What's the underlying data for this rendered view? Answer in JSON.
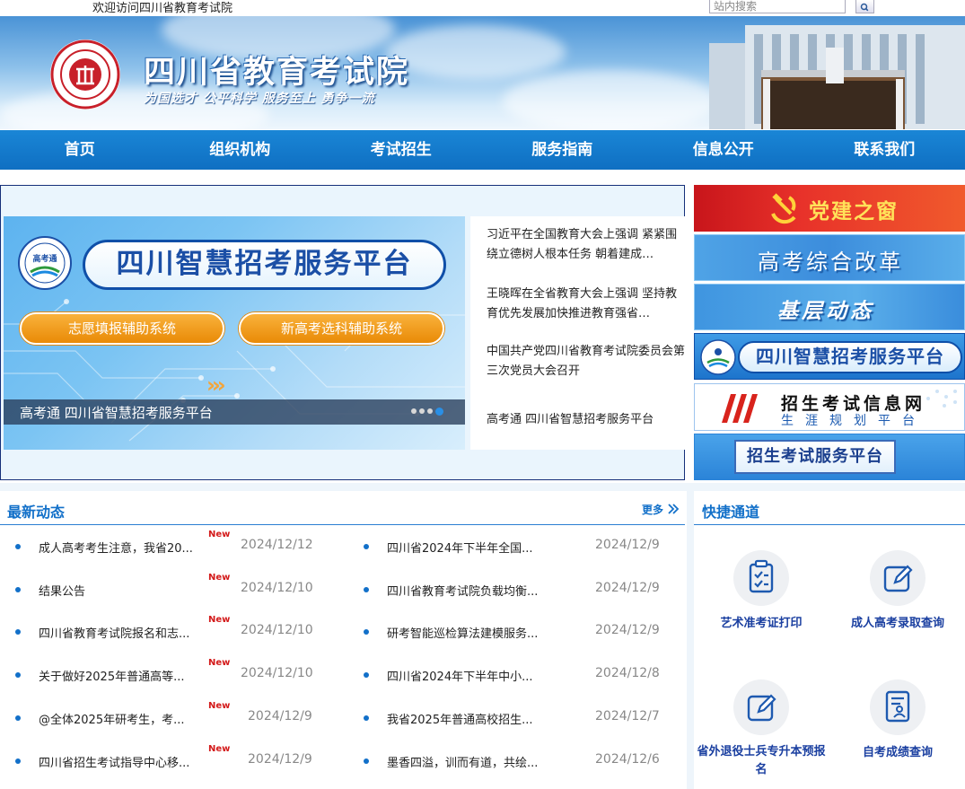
{
  "topbar": {
    "welcome": "欢迎访问四川省教育考试院",
    "search_placeholder": "站内搜索"
  },
  "header": {
    "title": "四川省教育考试院",
    "slogan": "为国选才  公平科学  服务至上  勇争一流"
  },
  "nav": {
    "items": [
      "首页",
      "组织机构",
      "考试招生",
      "服务指南",
      "信息公开",
      "联系我们"
    ]
  },
  "slider": {
    "title": "四川智慧招考服务平台",
    "button_1": "志愿填报辅助系统",
    "button_2": "新高考选科辅助系统",
    "caption": "高考通 四川省智慧招考服务平台",
    "logo_text": "高考通",
    "total_slides": 4,
    "active_slide": 4
  },
  "headlines": [
    "习近平在全国教育大会上强调 紧紧围绕立德树人根本任务 朝着建成…",
    "王晓晖在全省教育大会上强调 坚持教育优先发展加快推进教育强省…",
    "中国共产党四川省教育考试院委员会第三次党员大会召开",
    "高考通 四川省智慧招考服务平台"
  ],
  "side_banners": {
    "party": "党建之窗",
    "reform": "高考综合改革",
    "grassroots": "基层动态",
    "smart": "四川智慧招考服务平台",
    "info_line1": "招生考试信息网",
    "info_line2": "生涯规划平台",
    "service": "招生考试服务平台"
  },
  "news": {
    "title": "最新动态",
    "more": "更多",
    "new_badge": "New",
    "left": [
      {
        "text": "成人高考考生注意，我省20...",
        "date": "2024/12/12",
        "new": true
      },
      {
        "text": "结果公告",
        "date": "2024/12/10",
        "new": true
      },
      {
        "text": "四川省教育考试院报名和志...",
        "date": "2024/12/10",
        "new": true
      },
      {
        "text": "关于做好2025年普通高等...",
        "date": "2024/12/10",
        "new": true
      },
      {
        "text": "@全体2025年研考生，考...",
        "date": "2024/12/9",
        "new": true
      },
      {
        "text": "四川省招生考试指导中心移...",
        "date": "2024/12/9",
        "new": true
      }
    ],
    "right": [
      {
        "text": "四川省2024年下半年全国...",
        "date": "2024/12/9"
      },
      {
        "text": "四川省教育考试院负载均衡...",
        "date": "2024/12/9"
      },
      {
        "text": "研考智能巡检算法建模服务...",
        "date": "2024/12/9"
      },
      {
        "text": "四川省2024年下半年中小...",
        "date": "2024/12/8"
      },
      {
        "text": "我省2025年普通高校招生...",
        "date": "2024/12/7"
      },
      {
        "text": "墨香四溢，训而有道，共绘...",
        "date": "2024/12/6"
      }
    ]
  },
  "quick": {
    "title": "快捷通道",
    "items": [
      {
        "label": "艺术准考证打印",
        "icon": "clipboard-check-icon"
      },
      {
        "label": "成人高考录取查询",
        "icon": "pencil-square-icon"
      },
      {
        "label": "省外退役士兵专升本预报名",
        "icon": "pencil-square-icon"
      },
      {
        "label": "自考成绩查询",
        "icon": "document-person-icon"
      }
    ]
  },
  "colors": {
    "nav_blue": "#1177cc",
    "accent_blue": "#1270c9",
    "new_red": "#d31a1a"
  }
}
